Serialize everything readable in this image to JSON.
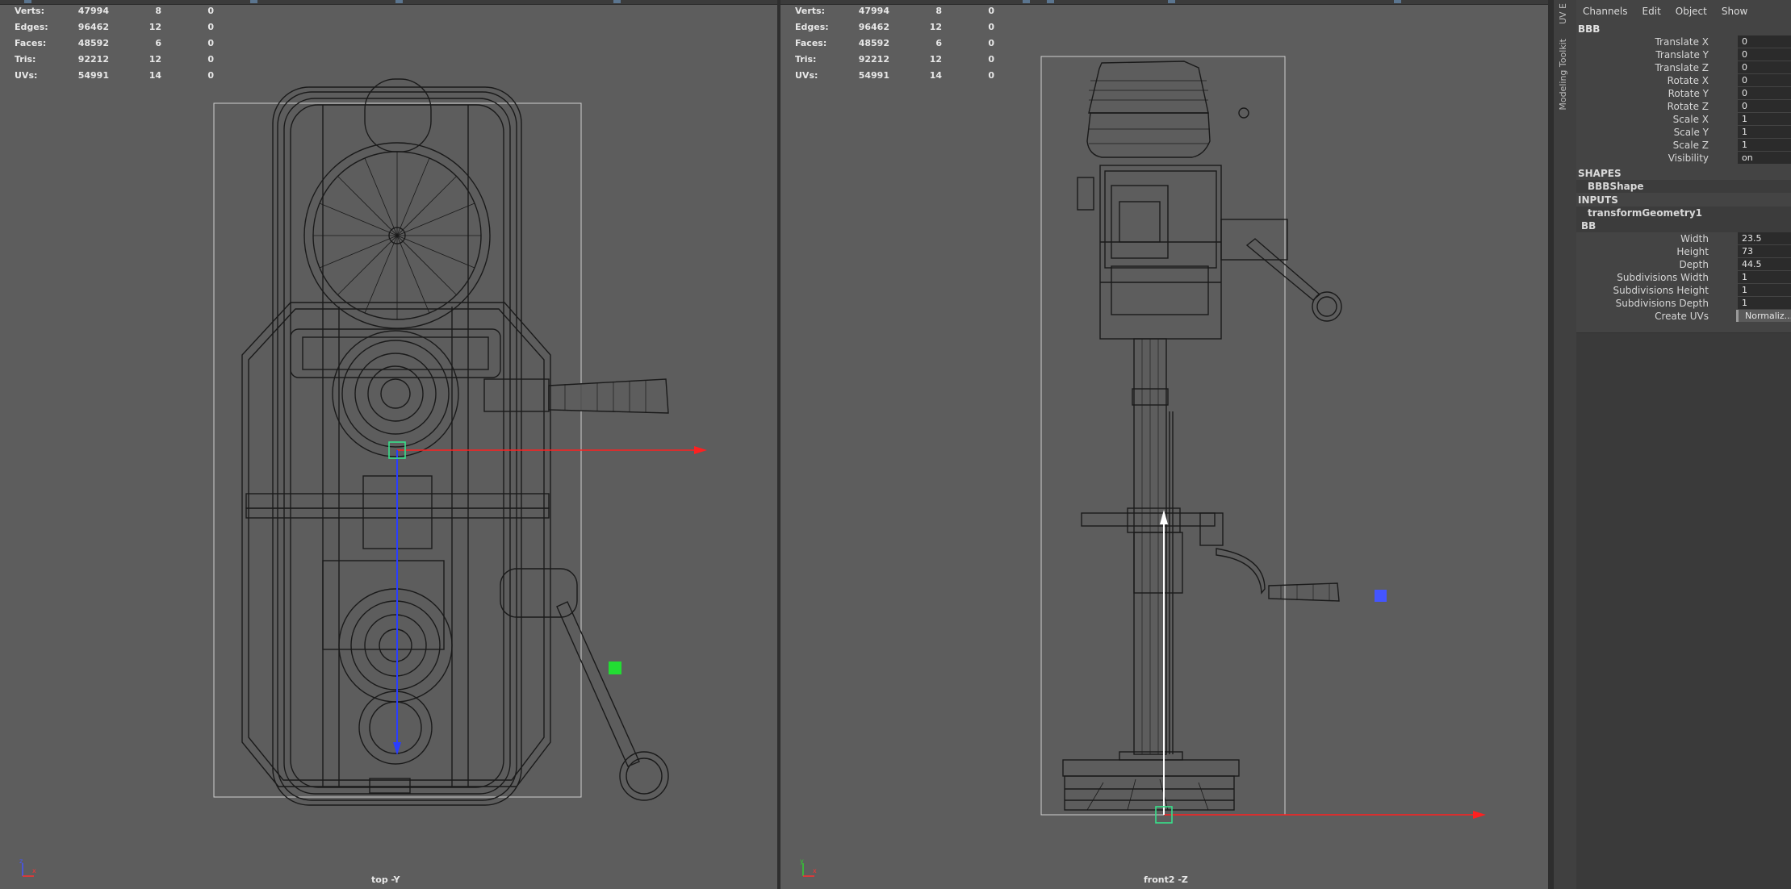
{
  "hud_stats": {
    "rows": [
      {
        "label": "Verts:",
        "v1": "47994",
        "v2": "8",
        "v3": "0"
      },
      {
        "label": "Edges:",
        "v1": "96462",
        "v2": "12",
        "v3": "0"
      },
      {
        "label": "Faces:",
        "v1": "48592",
        "v2": "6",
        "v3": "0"
      },
      {
        "label": "Tris:",
        "v1": "92212",
        "v2": "12",
        "v3": "0"
      },
      {
        "label": "UVs:",
        "v1": "54991",
        "v2": "14",
        "v3": "0"
      }
    ]
  },
  "viewports": {
    "top": {
      "camera_label": "top -Y"
    },
    "front": {
      "camera_label": "front2 -Z"
    }
  },
  "side_tabs": {
    "uv": "UV E",
    "modeling": "Modeling Toolkit"
  },
  "channel_box": {
    "menu": [
      "Channels",
      "Edit",
      "Object",
      "Show"
    ],
    "object_name": "BBB",
    "transform_rows": [
      {
        "name": "Translate X",
        "value": "0"
      },
      {
        "name": "Translate Y",
        "value": "0"
      },
      {
        "name": "Translate Z",
        "value": "0"
      },
      {
        "name": "Rotate X",
        "value": "0"
      },
      {
        "name": "Rotate Y",
        "value": "0"
      },
      {
        "name": "Rotate Z",
        "value": "0"
      },
      {
        "name": "Scale X",
        "value": "1"
      },
      {
        "name": "Scale Y",
        "value": "1"
      },
      {
        "name": "Scale Z",
        "value": "1"
      },
      {
        "name": "Visibility",
        "value": "on"
      }
    ],
    "shapes_header": "SHAPES",
    "shape_node": "BBBShape",
    "inputs_header": "INPUTS",
    "input_node": "transformGeometry1",
    "input_node2": "BB",
    "input_rows": [
      {
        "name": "Width",
        "value": "23.5"
      },
      {
        "name": "Height",
        "value": "73"
      },
      {
        "name": "Depth",
        "value": "44.5"
      },
      {
        "name": "Subdivisions Width",
        "value": "1"
      },
      {
        "name": "Subdivisions Height",
        "value": "1"
      },
      {
        "name": "Subdivisions Depth",
        "value": "1"
      }
    ],
    "create_uvs": {
      "name": "Create UVs",
      "value": "Normaliz..."
    }
  },
  "colors": {
    "viewport_bg": "#5d5d5d",
    "wire": "#1a1a1a",
    "manip_x": "#ff2020",
    "manip_y": "#ffffff",
    "manip_z": "#2a3dff",
    "manip_center": "#38e08a",
    "pivot_green": "#22dd33",
    "pivot_blue": "#4455ff"
  }
}
